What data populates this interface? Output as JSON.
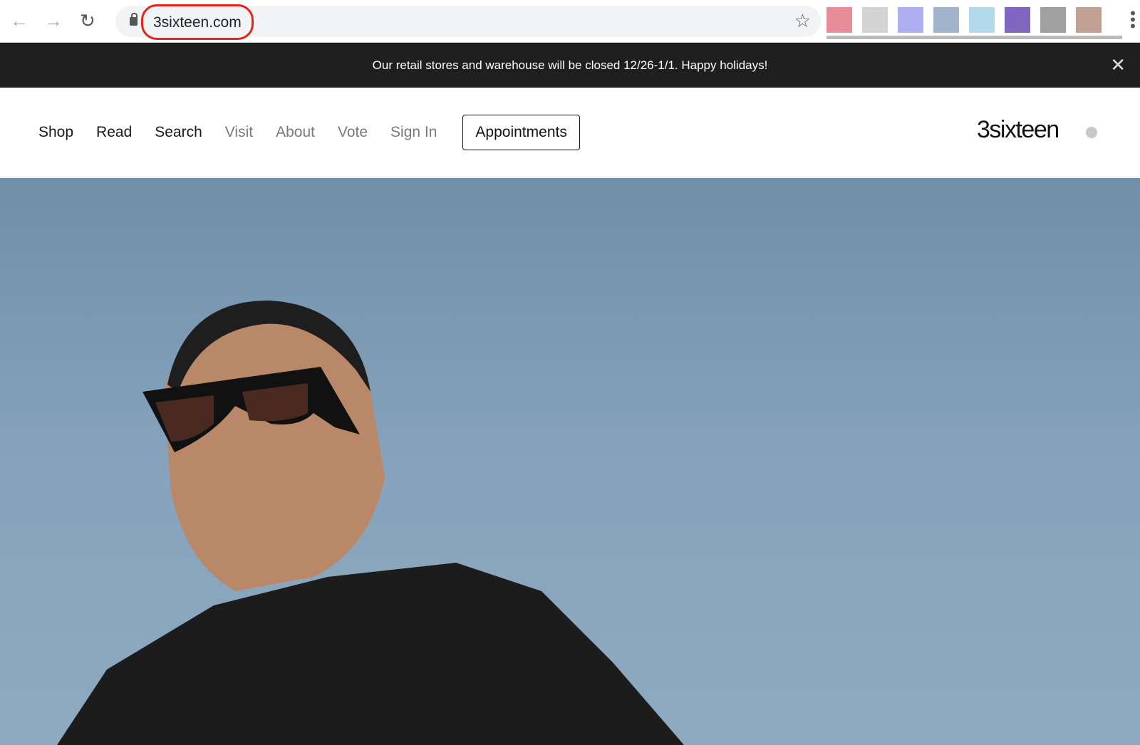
{
  "browser": {
    "url": "3sixteen.com",
    "back_icon": "←",
    "forward_icon": "→",
    "reload_icon": "↻",
    "star_icon": "☆"
  },
  "extension_colors": [
    "#e07080",
    "#c8c8c8",
    "#9a9af0",
    "#8aa0c0",
    "#a0d0e8",
    "#6040b0",
    "#888888",
    "#b08878"
  ],
  "banner": {
    "text": "Our retail stores and warehouse will be closed 12/26-1/1. Happy holidays!",
    "close": "✕"
  },
  "nav": {
    "items": [
      "Shop",
      "Read",
      "Search",
      "Visit",
      "About",
      "Vote",
      "Sign In"
    ],
    "appointments": "Appointments"
  },
  "logo": "3sixteen"
}
